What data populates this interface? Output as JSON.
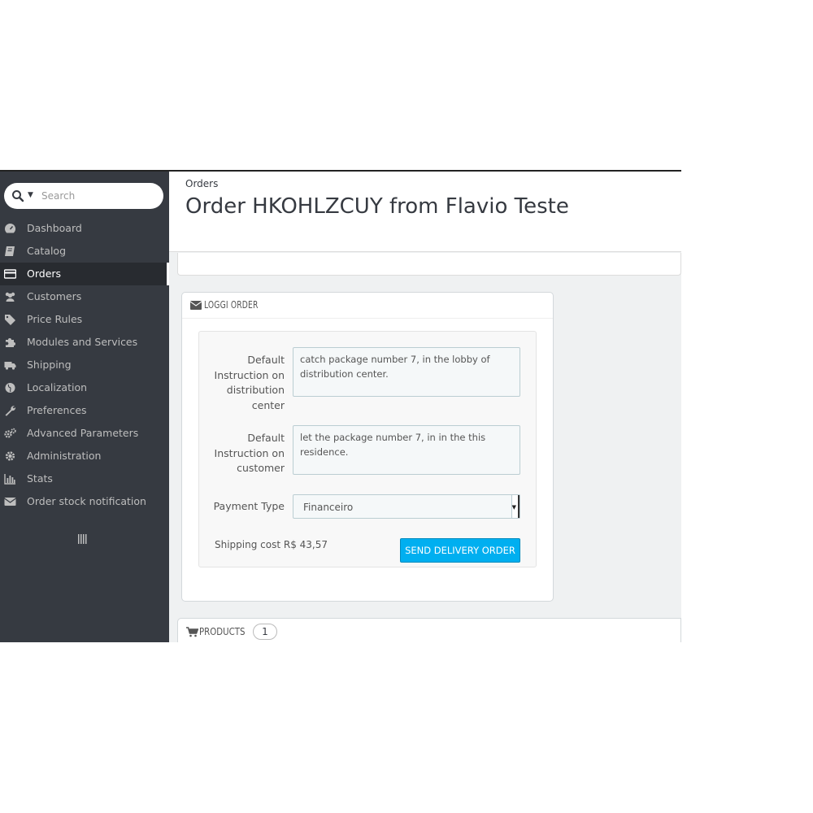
{
  "search": {
    "placeholder": "Search"
  },
  "sidebar": {
    "items": [
      {
        "label": "Dashboard",
        "icon": "dashboard-icon"
      },
      {
        "label": "Catalog",
        "icon": "book-icon"
      },
      {
        "label": "Orders",
        "icon": "credit-card-icon",
        "active": true
      },
      {
        "label": "Customers",
        "icon": "users-icon"
      },
      {
        "label": "Price Rules",
        "icon": "tags-icon"
      },
      {
        "label": "Modules and Services",
        "icon": "puzzle-icon"
      },
      {
        "label": "Shipping",
        "icon": "truck-icon"
      },
      {
        "label": "Localization",
        "icon": "globe-icon"
      },
      {
        "label": "Preferences",
        "icon": "wrench-icon"
      },
      {
        "label": "Advanced Parameters",
        "icon": "cogs-icon"
      },
      {
        "label": "Administration",
        "icon": "gear-icon"
      },
      {
        "label": "Stats",
        "icon": "bar-chart-icon"
      },
      {
        "label": "Order stock notification",
        "icon": "envelope-icon"
      }
    ]
  },
  "header": {
    "breadcrumb": "Orders",
    "title": "Order HKOHLZCUY from Flavio Teste"
  },
  "loggi": {
    "title": "LOGGI ORDER",
    "fields": {
      "distribution": {
        "label": "Default Instruction on distribution center",
        "value": "catch  package number 7,  in the lobby of distribution center."
      },
      "customer": {
        "label": "Default Instruction on customer",
        "value": "let the  package number 7,  in  in the  this residence."
      },
      "payment": {
        "label": "Payment Type",
        "value": "Financeiro"
      }
    },
    "shipping_cost": "Shipping cost R$ 43,57",
    "send_label": "SEND DELIVERY ORDER"
  },
  "products": {
    "title": "PRODUCTS",
    "count": "1"
  },
  "colors": {
    "sidebar_bg": "#363a41",
    "sidebar_active": "#282b30",
    "primary_button": "#00aff0",
    "content_bg": "#eff1f2"
  }
}
